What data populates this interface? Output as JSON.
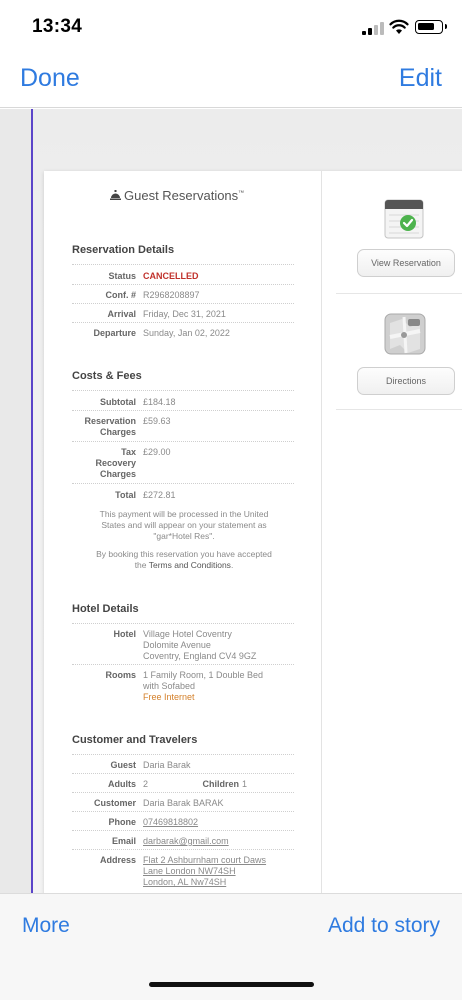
{
  "status_bar": {
    "time": "13:34"
  },
  "nav": {
    "done": "Done",
    "edit": "Edit"
  },
  "document": {
    "brand": "Guest Reservations",
    "brand_mark": "™",
    "reservation": {
      "title": "Reservation Details",
      "status_label": "Status",
      "status_value": "CANCELLED",
      "conf_label": "Conf. #",
      "conf_value": "R2968208897",
      "arrival_label": "Arrival",
      "arrival_value": "Friday, Dec 31, 2021",
      "departure_label": "Departure",
      "departure_value": "Sunday, Jan 02, 2022"
    },
    "costs": {
      "title": "Costs & Fees",
      "subtotal_label": "Subtotal",
      "subtotal_value": "£184.18",
      "res_charges_label_1": "Reservation",
      "res_charges_label_2": "Charges",
      "res_charges_value": "£59.63",
      "tax_label_1": "Tax",
      "tax_label_2": "Recovery",
      "tax_label_3": "Charges",
      "tax_value": "£29.00",
      "total_label": "Total",
      "total_value": "£272.81",
      "note_1": "This payment will be processed in the United",
      "note_2": "States and will appear on your statement as",
      "note_3": "\"gar*Hotel Res\".",
      "booking_1": "By booking this reservation you have accepted",
      "booking_2a": "the ",
      "booking_terms": "Terms and Conditions",
      "booking_2b": "."
    },
    "hotel": {
      "title": "Hotel Details",
      "hotel_label": "Hotel",
      "hotel_line_1": "Village Hotel Coventry",
      "hotel_line_2": "Dolomite Avenue",
      "hotel_line_3": "Coventry, England CV4 9GZ",
      "rooms_label": "Rooms",
      "rooms_line_1": "1 Family Room, 1 Double Bed",
      "rooms_line_2": "with Sofabed",
      "amenity": "Free Internet"
    },
    "customer": {
      "title": "Customer and Travelers",
      "guest_label": "Guest",
      "guest_value": "Daria Barak",
      "adults_label": "Adults",
      "adults_value": "2",
      "children_label": "Children",
      "children_value": "1",
      "customer_label": "Customer",
      "customer_value": "Daria Barak BARAK",
      "phone_label": "Phone",
      "phone_value": "07469818802",
      "email_label": "Email",
      "email_value": "darbarak@gmail.com",
      "address_label": "Address",
      "address_line_1": "Flat 2 Ashburnham court Daws",
      "address_line_2": "Lane London NW74SH",
      "address_line_3": "London, AL Nw74SH"
    },
    "actions": {
      "view_reservation": "View Reservation",
      "directions": "Directions"
    }
  },
  "bottom_bar": {
    "more": "More",
    "add_to_story": "Add to story"
  },
  "colors": {
    "accent": "#2f7be0",
    "cancelled": "#c0312b",
    "amenity": "#d4802a",
    "scroll_indicator": "#5b45c9"
  }
}
